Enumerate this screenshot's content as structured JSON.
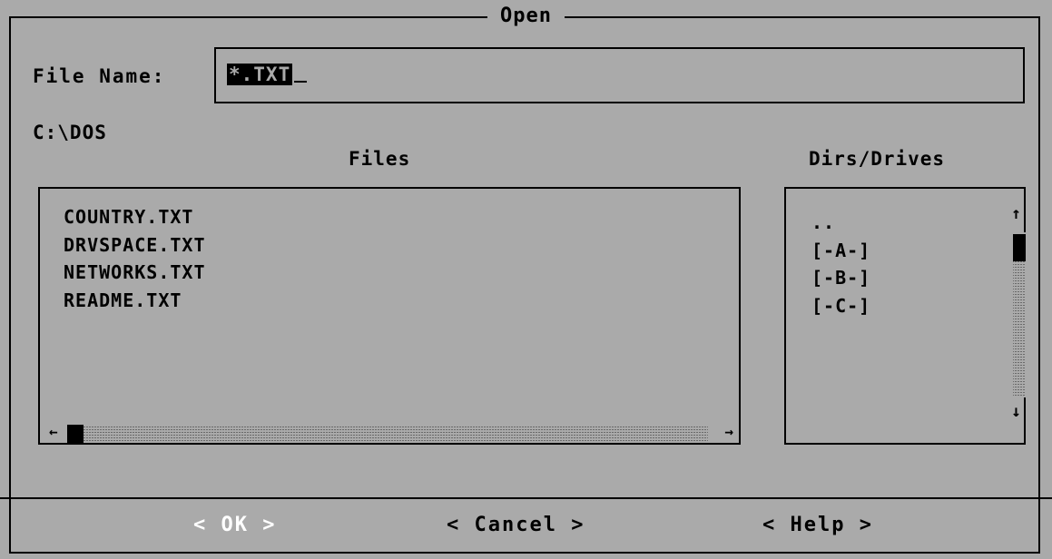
{
  "dialog": {
    "title": "Open",
    "file_name_label": "File Name:",
    "file_name_value": "*.TXT",
    "current_dir": "C:\\DOS",
    "files_label": "Files",
    "dirs_label": "Dirs/Drives",
    "files": [
      "COUNTRY.TXT",
      "DRVSPACE.TXT",
      "NETWORKS.TXT",
      "README.TXT"
    ],
    "dirs": [
      "..",
      "[-A-]",
      "[-B-]",
      "[-C-]"
    ],
    "buttons": {
      "ok": "< OK >",
      "cancel": "< Cancel >",
      "help": "< Help >"
    }
  },
  "icons": {
    "left_arrow": "←",
    "right_arrow": "→",
    "up_arrow": "↑",
    "down_arrow": "↓"
  },
  "colors": {
    "background": "#aaaaaa",
    "foreground": "#000000",
    "default_button": "#ffffff",
    "selection_bg": "#000000",
    "selection_fg": "#aaaaaa"
  }
}
